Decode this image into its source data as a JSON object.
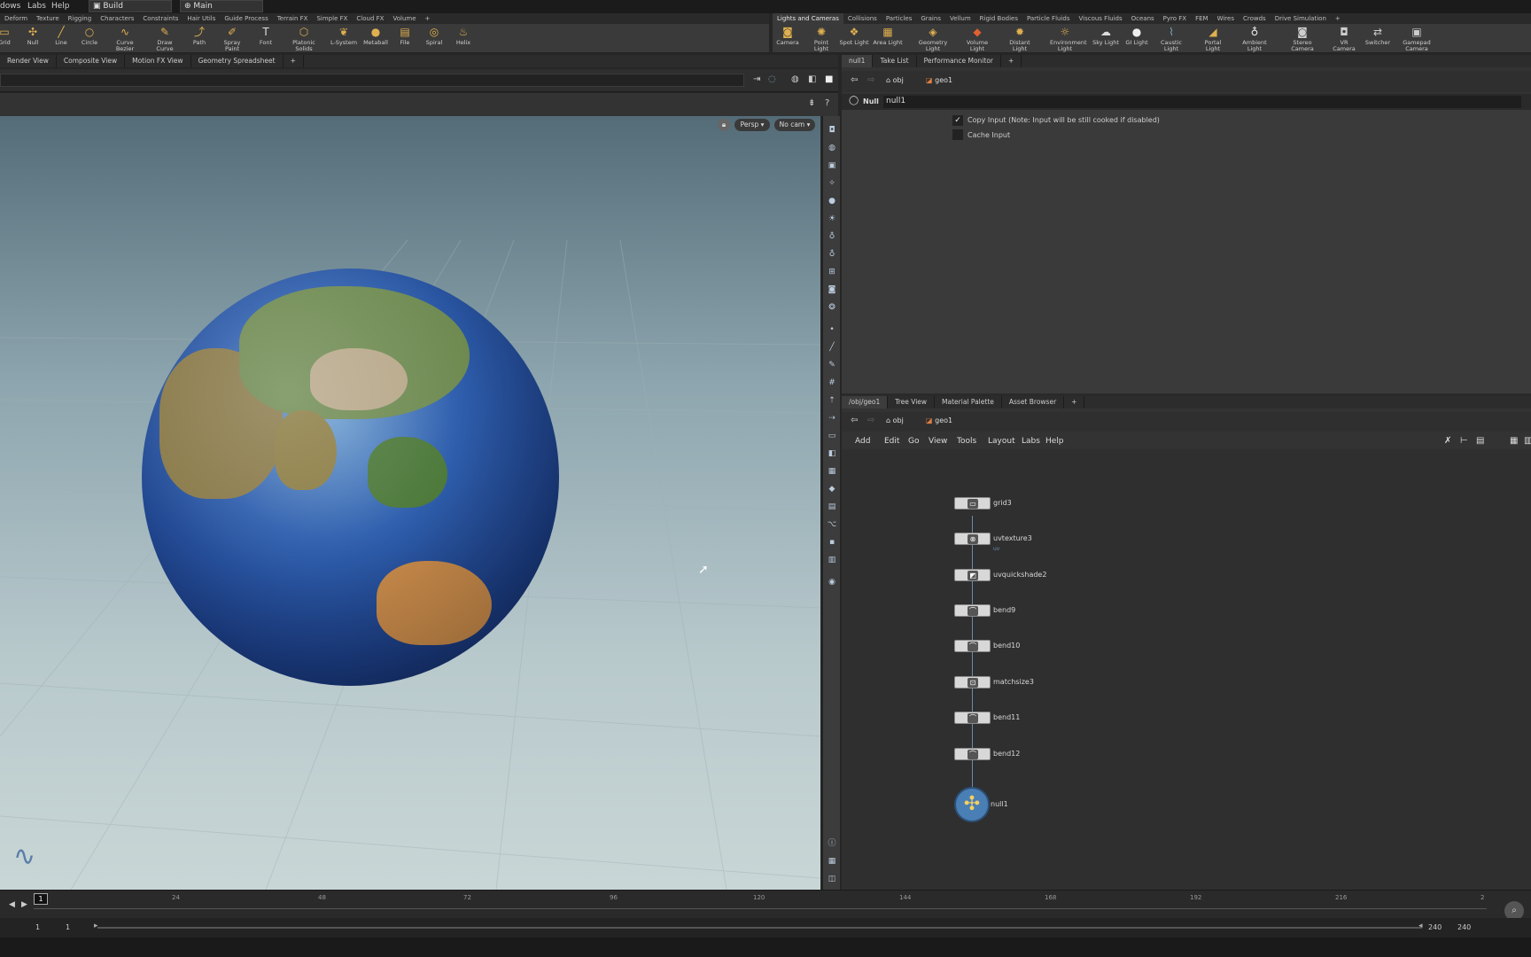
{
  "menubar": {
    "items": [
      "dows",
      "Labs",
      "Help"
    ],
    "desktop": "Build",
    "network": "Main"
  },
  "shelf_left": {
    "tabs": [
      "Deform",
      "Texture",
      "Rigging",
      "Characters",
      "Constraints",
      "Hair Utils",
      "Guide Process",
      "Terrain FX",
      "Simple FX",
      "Cloud FX",
      "Volume",
      "+"
    ],
    "tools": [
      "Grid",
      "Null",
      "Line",
      "Circle",
      "Curve Bezier",
      "Draw Curve",
      "Path",
      "Spray Paint",
      "Font",
      "Platonic Solids",
      "L-System",
      "Metaball",
      "File",
      "Spiral",
      "Helix"
    ]
  },
  "shelf_right": {
    "tabs": [
      "Lights and Cameras",
      "Collisions",
      "Particles",
      "Grains",
      "Vellum",
      "Rigid Bodies",
      "Particle Fluids",
      "Viscous Fluids",
      "Oceans",
      "Pyro FX",
      "FEM",
      "Wires",
      "Crowds",
      "Drive Simulation",
      "+"
    ],
    "tools": [
      "Camera",
      "Point Light",
      "Spot Light",
      "Area Light",
      "Geometry Light",
      "Volume Light",
      "Distant Light",
      "Environment Light",
      "Sky Light",
      "GI Light",
      "Caustic Light",
      "Portal Light",
      "Ambient Light",
      "Stereo Camera",
      "VR Camera",
      "Switcher",
      "Gamepad Camera"
    ]
  },
  "left_pane": {
    "tabs": [
      "Render View",
      "Composite View",
      "Motion FX View",
      "Geometry Spreadsheet",
      "+"
    ],
    "viewport_menu": {
      "persp": "Persp ▾",
      "cam": "No cam ▾"
    }
  },
  "params_pane": {
    "tabs": [
      "null1",
      "Take List",
      "Performance Monitor",
      "+"
    ],
    "path": [
      "obj",
      "geo1"
    ],
    "node_type": "Null",
    "node_name": "null1",
    "options": [
      {
        "label": "Copy Input (Note: Input will be still cooked if disabled)",
        "checked": true
      },
      {
        "label": "Cache Input",
        "checked": false
      }
    ]
  },
  "network_pane": {
    "tabs": [
      "/obj/geo1",
      "Tree View",
      "Material Palette",
      "Asset Browser",
      "+"
    ],
    "path": [
      "obj",
      "geo1"
    ],
    "menu": [
      "Add",
      "Edit",
      "Go",
      "View",
      "Tools",
      "Layout",
      "Labs",
      "Help"
    ],
    "nodes": [
      "grid3",
      "uvtexture3",
      "uvquickshade2",
      "bend9",
      "bend10",
      "matchsize3",
      "bend11",
      "bend12",
      "null1"
    ],
    "subtext": "uv"
  },
  "timeline": {
    "current_frame": "1",
    "ticks": [
      "24",
      "48",
      "72",
      "96",
      "120",
      "144",
      "168",
      "192",
      "216",
      "2"
    ],
    "start": "1",
    "start2": "1",
    "end": "240",
    "end2": "240"
  },
  "colors": {
    "accent": "#e0b050",
    "selected_node": "#4a7fb5"
  }
}
